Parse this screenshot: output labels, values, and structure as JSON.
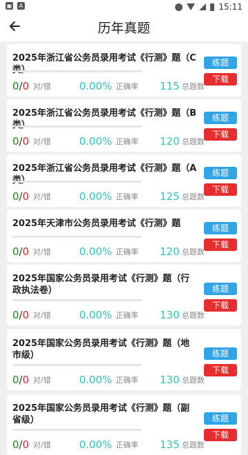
{
  "status_bar": {
    "time": "15:11",
    "icons": [
      "notification-icon",
      "app-icon",
      "do-not-disturb-icon",
      "wifi-icon",
      "signal-icon",
      "battery-icon"
    ]
  },
  "header": {
    "title": "历年真题"
  },
  "labels": {
    "correct_wrong": "对/错",
    "accuracy": "正确率",
    "total": "总题数",
    "practice": "练题",
    "download": "下载"
  },
  "colors": {
    "correct": "#1a8a1a",
    "wrong": "#d42a2a",
    "accent": "#2ec4b6",
    "practice_button": "#2fa4e7",
    "download_button": "#e52d2d"
  },
  "exams": [
    {
      "title": "2025年浙江省公务员录用考试《行测》题（C类）",
      "correct": "0",
      "wrong": "0",
      "accuracy": "0.00%",
      "total": "115",
      "progress": 0
    },
    {
      "title": "2025年浙江省公务员录用考试《行测》题（B类）",
      "correct": "0",
      "wrong": "0",
      "accuracy": "0.00%",
      "total": "120",
      "progress": 0
    },
    {
      "title": "2025年浙江省公务员录用考试《行测》题（A类）",
      "correct": "0",
      "wrong": "0",
      "accuracy": "0.00%",
      "total": "125",
      "progress": 0
    },
    {
      "title": "2025年天津市公务员录用考试《行测》题",
      "correct": "0",
      "wrong": "0",
      "accuracy": "0.00%",
      "total": "120",
      "progress": 0
    },
    {
      "title": "2025年国家公务员录用考试《行测》题（行政执法卷）",
      "correct": "0",
      "wrong": "0",
      "accuracy": "0.00%",
      "total": "130",
      "progress": 0
    },
    {
      "title": "2025年国家公务员录用考试《行测》题（地市级）",
      "correct": "0",
      "wrong": "0",
      "accuracy": "0.00%",
      "total": "130",
      "progress": 0
    },
    {
      "title": "2025年国家公务员录用考试《行测》题（副省级）",
      "correct": "0",
      "wrong": "0",
      "accuracy": "0.00%",
      "total": "135",
      "progress": 0
    }
  ]
}
